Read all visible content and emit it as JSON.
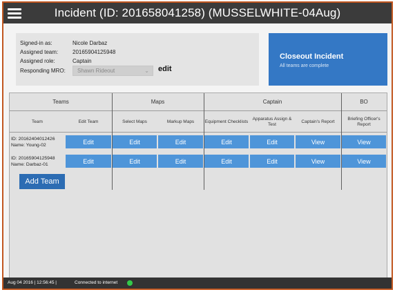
{
  "app": {
    "title": "Incident (ID: 201658041258) (MUSSELWHITE-04Aug)"
  },
  "info": {
    "signed_in_label": "Signed-in as:",
    "signed_in_value": "Nicole Darbaz",
    "team_label": "Assigned team:",
    "team_value": "20165904125948",
    "role_label": "Assigned role:",
    "role_value": "Captain",
    "mro_label": "Responding MRO:",
    "mro_value": "Shawn Rideout",
    "mro_edit": "edit"
  },
  "closeout": {
    "title": "Closeout Incident",
    "subtitle": "All teams are complete"
  },
  "board": {
    "groups": [
      "Teams",
      "Maps",
      "Captain",
      "BO"
    ],
    "columns": [
      "Team",
      "Edit Team",
      "Select Maps",
      "Markup Maps",
      "Equipment Checklists",
      "Apparatus Assign & Test",
      "Captain's Report",
      "Briefing Officer's Report"
    ],
    "teams": [
      {
        "id_line": "ID: 20162404012426",
        "name_line": "Name: Young-02",
        "actions": [
          "Edit",
          "Edit",
          "Edit",
          "Edit",
          "Edit",
          "View",
          "View"
        ]
      },
      {
        "id_line": "ID: 20165904125948",
        "name_line": "Name: Darbaz-01",
        "actions": [
          "Edit",
          "Edit",
          "Edit",
          "Edit",
          "Edit",
          "View",
          "View"
        ]
      }
    ],
    "add_team": "Add Team"
  },
  "status": {
    "datetime": "Aug 04 2016 | 12:56:45 |",
    "connection": "Connected to internet",
    "connection_color": "#34c94a"
  },
  "colors": {
    "accent": "#3478c5",
    "button": "#4e95d9",
    "frame_border": "#c1561e",
    "topbar": "#3b3b3b"
  }
}
